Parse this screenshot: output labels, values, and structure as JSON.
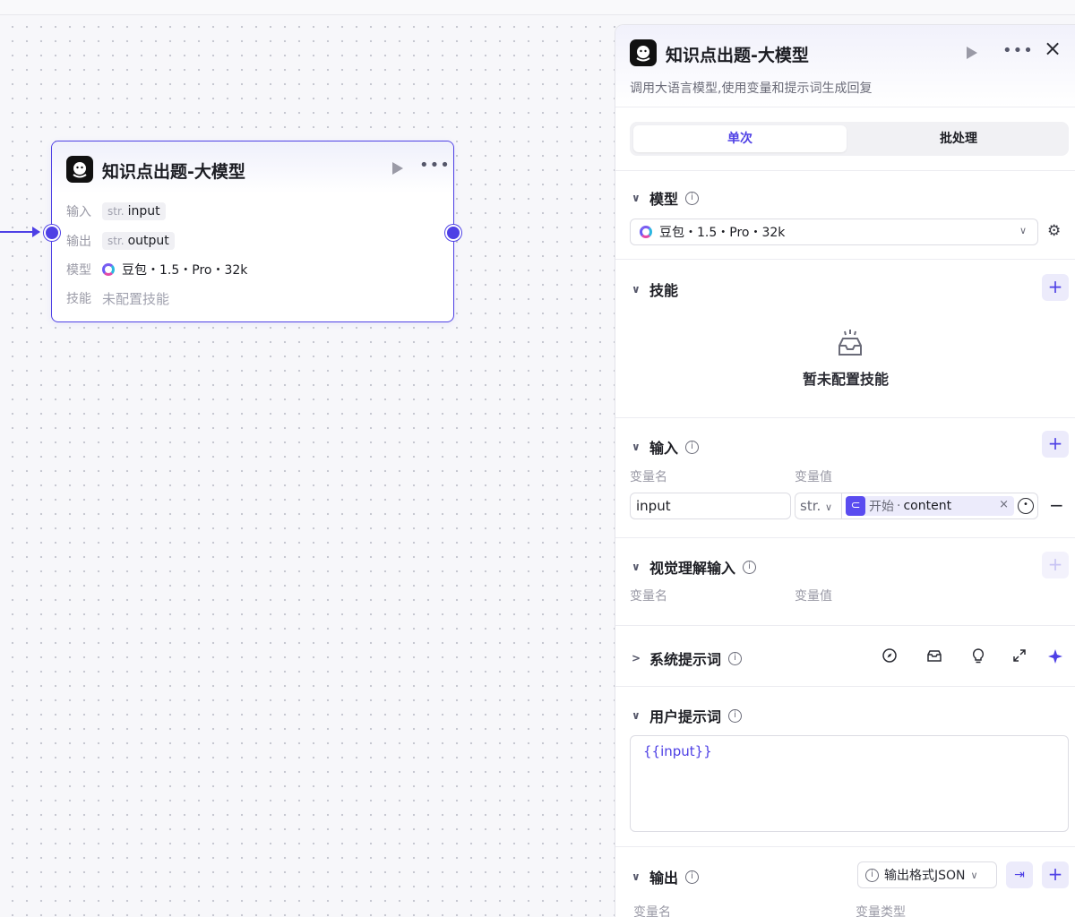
{
  "canvas": {
    "node": {
      "title": "知识点出题-大模型",
      "icons": {
        "logo": "bot-avatar-icon",
        "run": "play-icon",
        "more": "more-dots-icon"
      },
      "input_label": "输入",
      "input_type": "str.",
      "input_name": "input",
      "output_label": "输出",
      "output_type": "str.",
      "output_name": "output",
      "model_label": "模型",
      "model_value": "豆包・1.5・Pro・32k",
      "skill_label": "技能",
      "skill_value": "未配置技能"
    }
  },
  "panel": {
    "title": "知识点出题-大模型",
    "description": "调用大语言模型,使用变量和提示词生成回复",
    "close_glyph": "×",
    "tabs": {
      "single": "单次",
      "batch": "批处理"
    },
    "model": {
      "section": "模型",
      "selected": "豆包・1.5・Pro・32k"
    },
    "skills": {
      "section": "技能",
      "empty": "暂未配置技能"
    },
    "inputs": {
      "section": "输入",
      "col_name": "变量名",
      "col_value": "变量值",
      "row": {
        "name": "input",
        "type": "str.",
        "ref_source": "开始",
        "ref_sep": "·",
        "ref_field": "content"
      }
    },
    "vision": {
      "section": "视觉理解输入",
      "col_name": "变量名",
      "col_value": "变量值"
    },
    "system_prompt": {
      "section": "系统提示词"
    },
    "user_prompt": {
      "section": "用户提示词",
      "value": "{{input}}"
    },
    "output": {
      "section": "输出",
      "format": "输出格式JSON",
      "col_name": "变量名",
      "col_type": "变量类型"
    }
  },
  "colors": {
    "accent": "#4e40e5",
    "canvas_bg": "#f7f7fa",
    "border": "#dcdce3"
  }
}
